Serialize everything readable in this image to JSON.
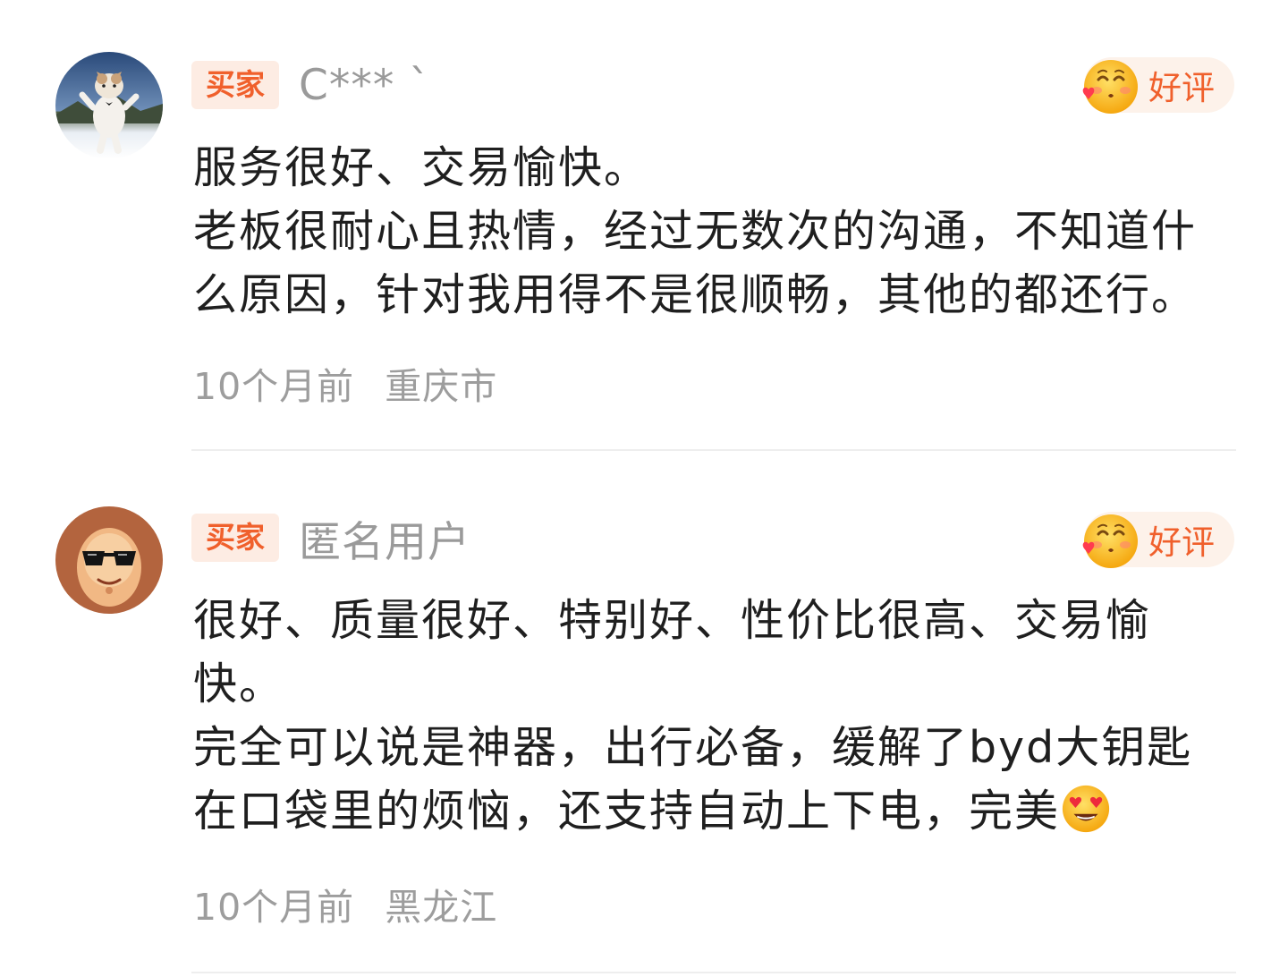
{
  "reviews": [
    {
      "buyer_tag": "买家",
      "username": "C*** `",
      "rating": "好评",
      "avatar_icon": "cat-photo-avatar",
      "rating_icon": "blushing-face-icon",
      "text": "服务很好、交易愉快。\n老板很耐心且热情，经过无数次的沟通，不知道什\n么原因，针对我用得不是很顺畅，其他的都还行。",
      "time": "10个月前",
      "location": "重庆市"
    },
    {
      "buyer_tag": "买家",
      "username": "匿名用户",
      "rating": "好评",
      "avatar_icon": "sunglasses-character-avatar",
      "rating_icon": "blushing-face-icon",
      "text_main": "很好、质量很好、特别好、性价比很高、交易愉\n快。\n完全可以说是神器，出行必备，缓解了byd大钥匙\n在口袋里的烦恼，还支持自动上下电，完美",
      "trailing_emoji": "heart-eyes-emoji",
      "time": "10个月前",
      "location": "黑龙江"
    }
  ],
  "colors": {
    "accent": "#f0602c",
    "tag_bg": "#fdece3",
    "badge_bg": "#fdf2ea",
    "muted": "#9d9d9d",
    "text": "#1f1f1f"
  }
}
